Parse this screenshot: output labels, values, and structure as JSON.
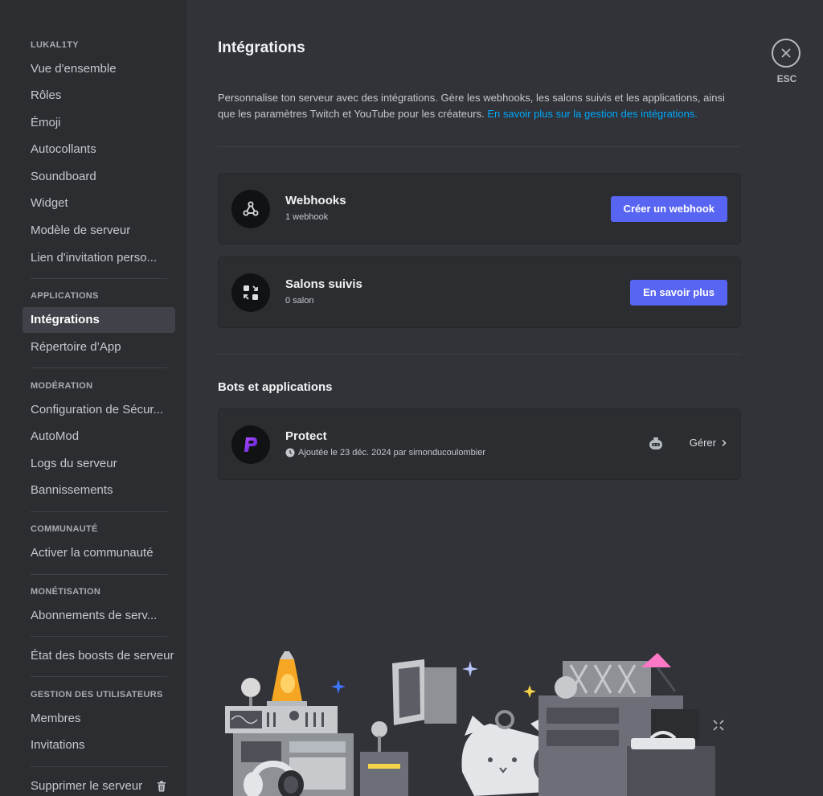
{
  "sidebar": {
    "server_name": "LUKAL1TY",
    "items_general": [
      {
        "label": "Vue d'ensemble"
      },
      {
        "label": "Rôles"
      },
      {
        "label": "Émoji"
      },
      {
        "label": "Autocollants"
      },
      {
        "label": "Soundboard"
      },
      {
        "label": "Widget"
      },
      {
        "label": "Modèle de serveur"
      },
      {
        "label": "Lien d'invitation perso..."
      }
    ],
    "section_apps": "APPLICATIONS",
    "items_apps": [
      {
        "label": "Intégrations"
      },
      {
        "label": "Répertoire d’App"
      }
    ],
    "section_moderation": "MODÉRATION",
    "items_moderation": [
      {
        "label": "Configuration de Sécur..."
      },
      {
        "label": "AutoMod"
      },
      {
        "label": "Logs du serveur"
      },
      {
        "label": "Bannissements"
      }
    ],
    "section_community": "COMMUNAUTÉ",
    "items_community": [
      {
        "label": "Activer la communauté"
      }
    ],
    "section_monetization": "MONÉTISATION",
    "items_monetization": [
      {
        "label": "Abonnements de serv..."
      }
    ],
    "boost_status": "État des boosts de serveur",
    "section_users": "GESTION DES UTILISATEURS",
    "items_users": [
      {
        "label": "Membres"
      },
      {
        "label": "Invitations"
      }
    ],
    "delete_server": "Supprimer le serveur"
  },
  "main": {
    "title": "Intégrations",
    "description": "Personnalise ton serveur avec des intégrations. Gère les webhooks, les salons suivis et les applications, ainsi que les paramètres Twitch et YouTube pour les créateurs.",
    "learn_more_link": "En savoir plus sur la gestion des intégrations.",
    "webhooks": {
      "title": "Webhooks",
      "subtitle": "1 webhook",
      "button": "Créer un webhook",
      "icon": "webhook-icon"
    },
    "followed_channels": {
      "title": "Salons suivis",
      "subtitle": "0 salon",
      "button": "En savoir plus",
      "icon": "followed-channels-icon"
    },
    "bots_heading": "Bots et applications",
    "bot": {
      "name": "Protect",
      "added": "Ajoutée le 23 déc. 2024 par simonducoulombier",
      "manage": "Gérer"
    }
  },
  "esc_label": "ESC",
  "colors": {
    "accent": "#5865f2",
    "link": "#00a8fc",
    "background": "#313338",
    "sidebar": "#2b2d31"
  }
}
